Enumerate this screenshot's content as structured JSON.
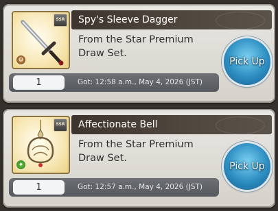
{
  "items": [
    {
      "name": "Spy's Sleeve Dagger",
      "description_line1": "From the Star Premium",
      "description_line2": "Draw Set.",
      "rarity": "SSR",
      "element_icon": "earth-element-icon",
      "count": "1",
      "obtained": "Got: 12:58 a.m., May 4, 2026 (JST)",
      "button_label": "Pick Up"
    },
    {
      "name": "Affectionate Bell",
      "description_line1": "From the Star Premium",
      "description_line2": "Draw Set.",
      "rarity": "SSR",
      "element_icon": "wind-element-icon",
      "count": "1",
      "obtained": "Got: 12:57 a.m., May 4, 2026 (JST)",
      "button_label": "Pick Up"
    }
  ],
  "colors": {
    "title_bar": "#3d352e",
    "button": "#2e8ec2",
    "footer": "#5f6266"
  }
}
